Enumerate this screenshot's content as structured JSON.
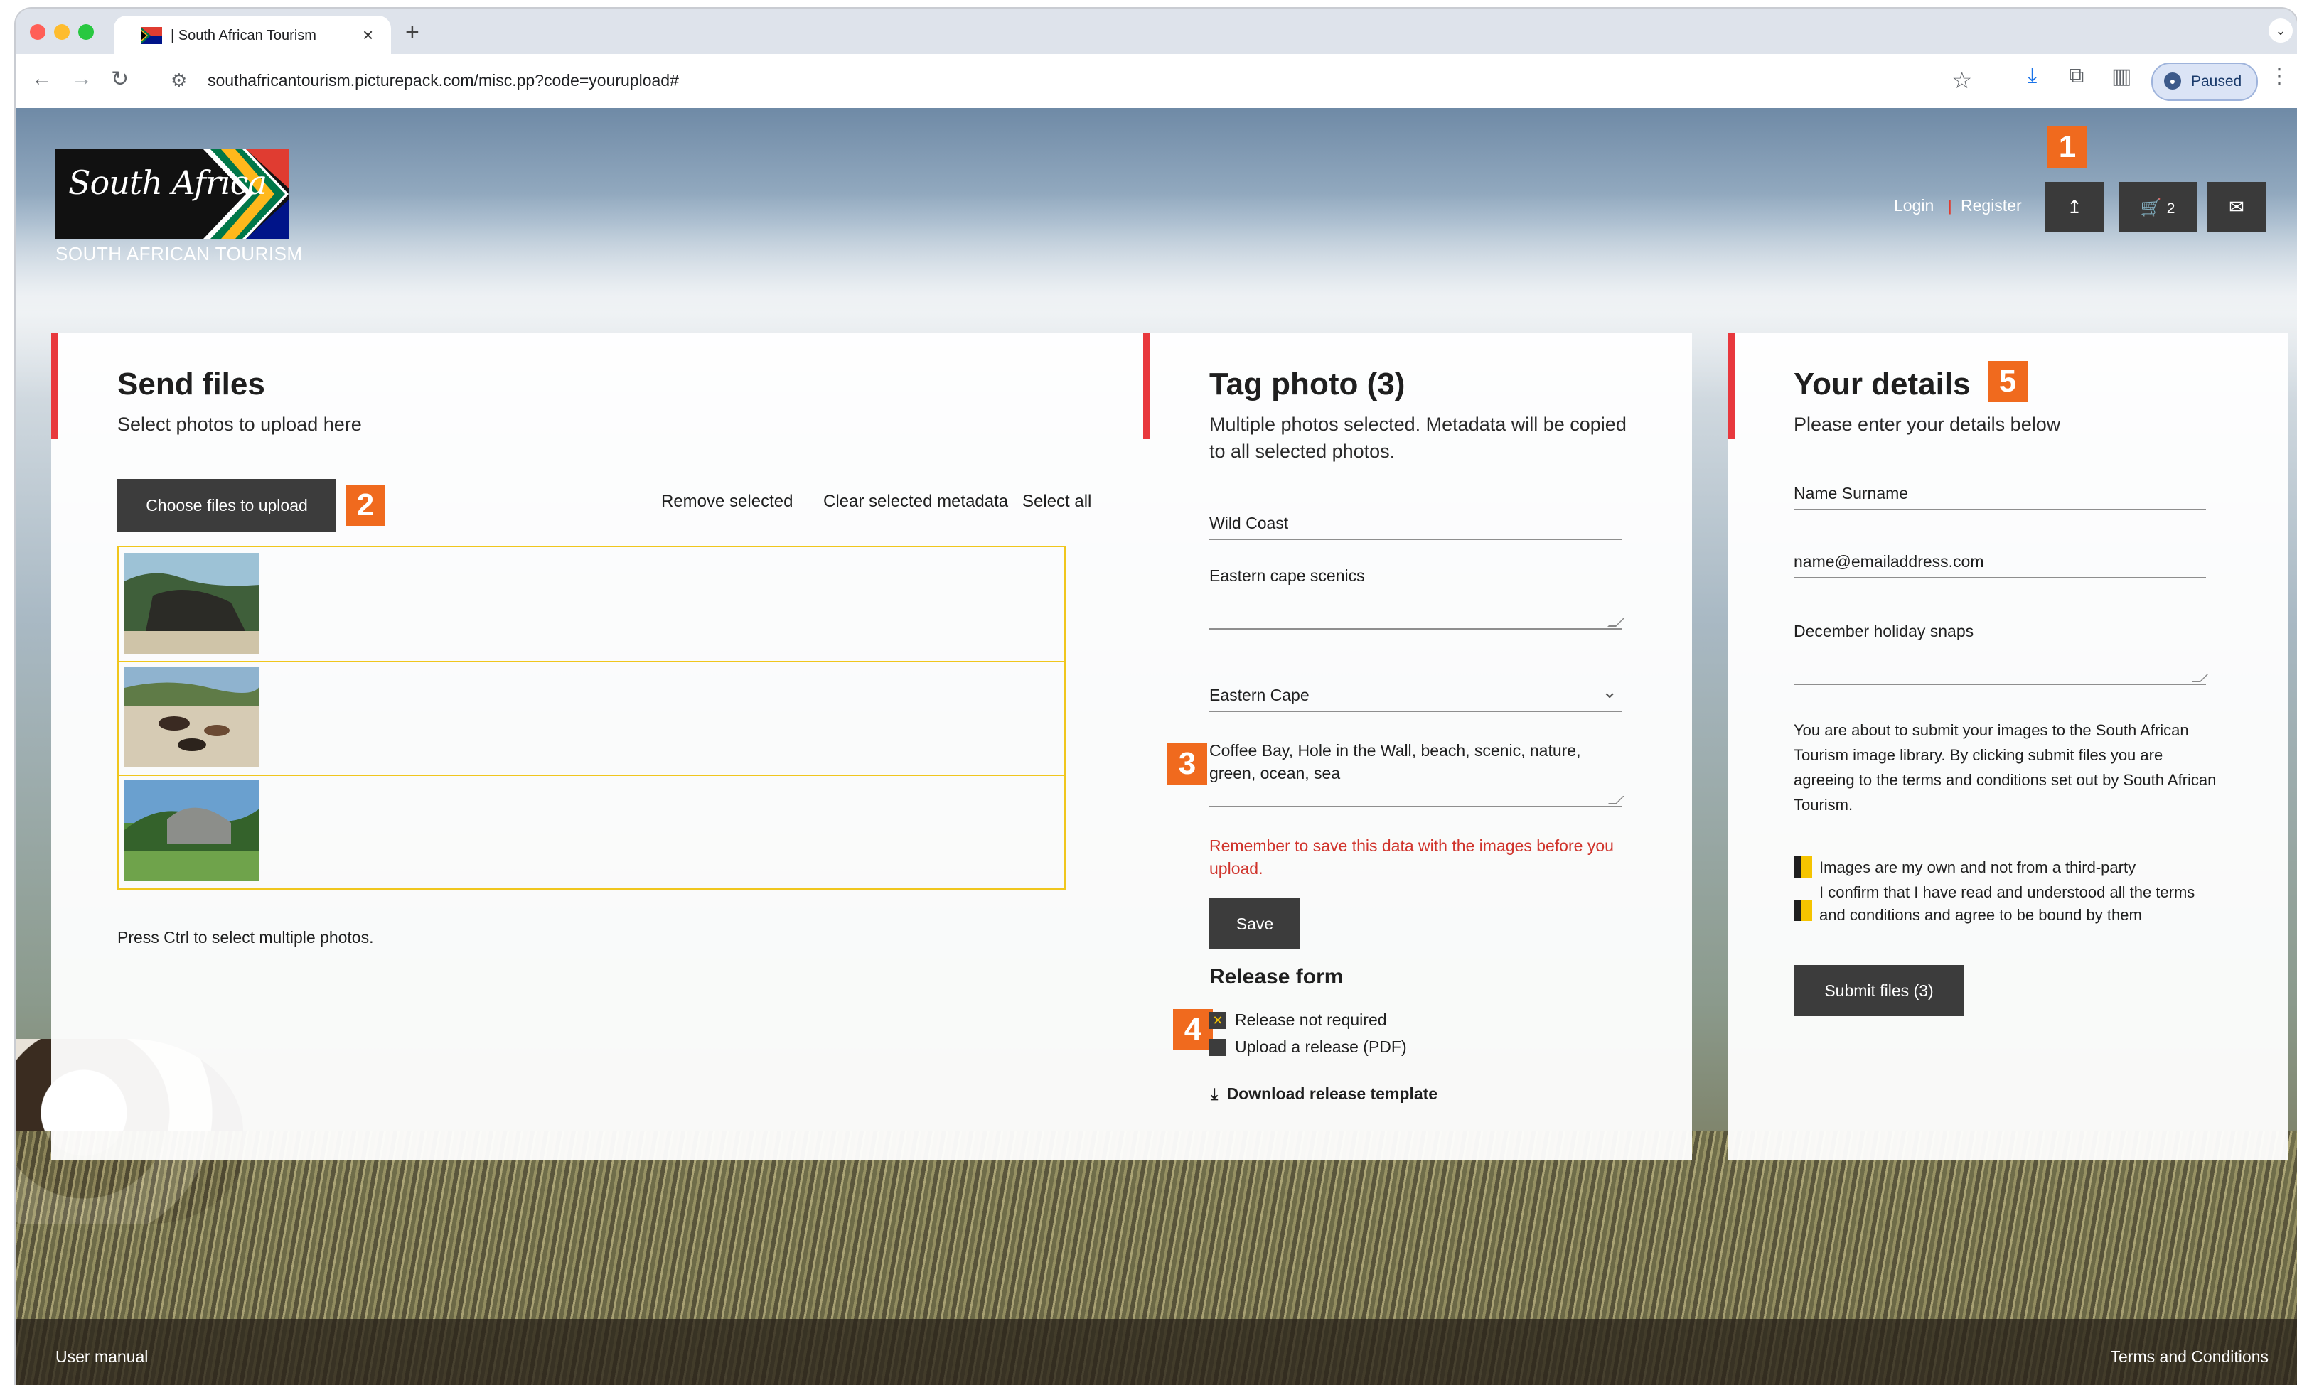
{
  "browser": {
    "tab_title": "| South African Tourism",
    "tab_close": "×",
    "new_tab": "+",
    "tab_dropdown": "⌄",
    "url": "southafricantourism.picturepack.com/misc.pp?code=yourupload#",
    "profile_label": "Paused",
    "icons": [
      "back-icon",
      "forward-icon",
      "reload-icon",
      "site-settings-icon",
      "bookmark-star-icon",
      "download-icon",
      "extensions-icon",
      "side-panel-icon",
      "profile-icon",
      "menu-icon"
    ]
  },
  "header": {
    "logo_script": "South Africa",
    "logo_subtitle": "SOUTH AFRICAN TOURISM",
    "login": "Login",
    "register": "Register",
    "upload_icon": "↥",
    "cart_icon": "🛒",
    "cart_count": "2",
    "mail_icon": "✉"
  },
  "markers": {
    "m1": "1",
    "m2": "2",
    "m3": "3",
    "m4": "4",
    "m5": "5"
  },
  "send_files": {
    "title": "Send files",
    "subtitle": "Select photos to upload here",
    "choose_button": "Choose files to upload",
    "remove_selected": "Remove selected",
    "clear_metadata": "Clear selected metadata",
    "select_all": "Select all",
    "hint": "Press Ctrl to select multiple photos."
  },
  "tag_photo": {
    "title": "Tag photo (3)",
    "subtitle": "Multiple photos selected. Metadata will be copied to all selected photos.",
    "field_location": "Wild Coast",
    "field_description": "Eastern cape scenics",
    "field_region": "Eastern Cape",
    "field_keywords": "Coffee Bay, Hole in the Wall, beach, scenic, nature, green, ocean, sea",
    "warning": "Remember to save this data with the images before you upload.",
    "save_button": "Save",
    "release_heading": "Release form",
    "release_not_required": "Release not required",
    "release_upload": "Upload a release (PDF)",
    "release_check_mark": "✕",
    "download_arrow": "⤓",
    "download_template": "Download release template"
  },
  "your_details": {
    "title": "Your details",
    "subtitle": "Please enter your details below",
    "name_field": "Name Surname",
    "email_field": "name@emailaddress.com",
    "notes_field": "December holiday snaps",
    "terms_paragraph": "You are about to submit your images to the South African Tourism image library. By clicking submit files you are agreeing to the terms and conditions set out by South African Tourism.",
    "check_own_images": "Images are my own and not from a third-party",
    "check_terms": "I confirm that I have read and understood all the terms and conditions and agree to be bound by them",
    "submit_button": "Submit files  (3)"
  },
  "footer": {
    "user_manual": "User manual",
    "terms": "Terms and Conditions"
  },
  "colors": {
    "accent_red": "#e8383d",
    "marker_orange": "#f06a1e",
    "selection_yellow": "#f0c61d",
    "button_dark": "#3c3c3c",
    "warning_red": "#d0342c"
  }
}
